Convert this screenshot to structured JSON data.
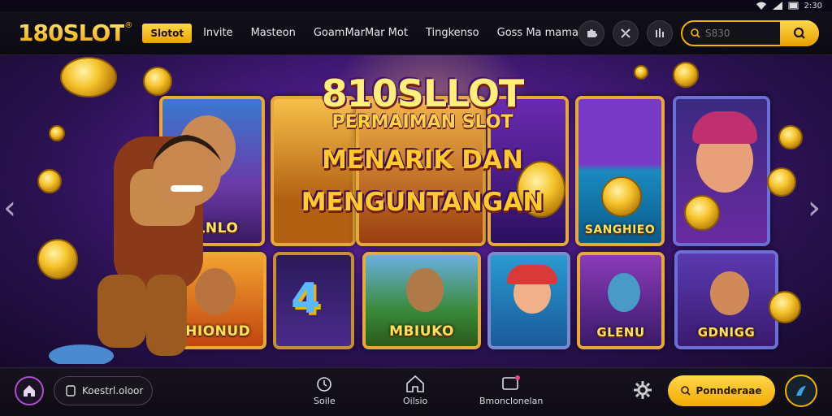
{
  "status_bar": {
    "time": "2:30"
  },
  "header": {
    "logo": "180SLOT",
    "logo_mark": "®",
    "nav_active": "Slotot",
    "nav_links": [
      "Invite",
      "Masteon",
      "GoamMarMar Mot",
      "Tingkenso",
      "Goss Ma mama"
    ],
    "search_placeholder": "S830"
  },
  "hero": {
    "title": "810SLLOT",
    "subtitle": "PERMAIMAN SLOT",
    "headline_1": "MENARIK DAN",
    "headline_2": "MENGUNTANGAN",
    "cards": [
      {
        "label": "PLNLO"
      },
      {
        "label": "SANGHIEO"
      },
      {
        "label": "GHIONUD"
      },
      {
        "label": "MBIUKO"
      },
      {
        "label": "GLENU"
      },
      {
        "label": "GDNIGG"
      }
    ]
  },
  "bottom_bar": {
    "search_pill": "Koestrl.oloor",
    "nav_items": [
      {
        "label": "Soile",
        "icon": "alarm-icon"
      },
      {
        "label": "Oilsio",
        "icon": "home-icon"
      },
      {
        "label": "Bmonclonelan",
        "icon": "inbox-icon"
      }
    ],
    "cta_label": "Ponnderaae"
  },
  "colors": {
    "accent": "#f0b400",
    "hero_purple": "#4a1c86",
    "card_border": "#e8a83a"
  }
}
